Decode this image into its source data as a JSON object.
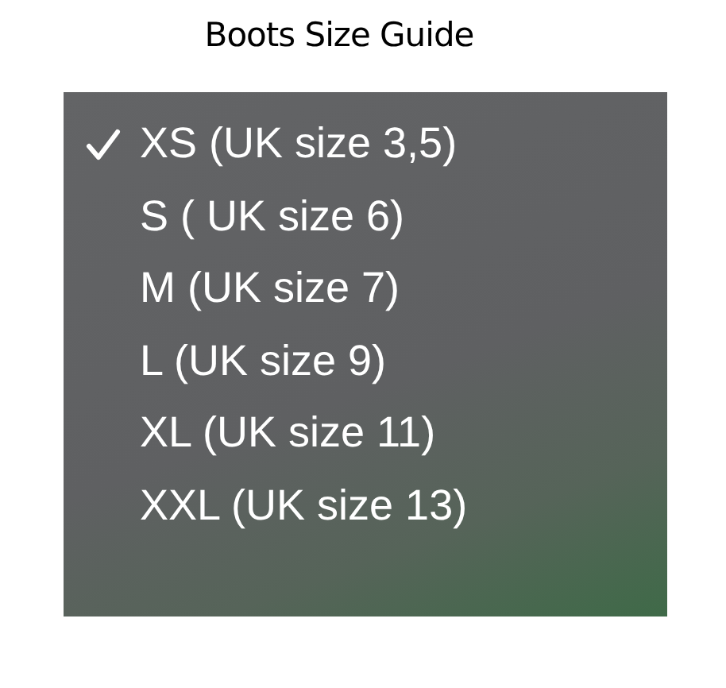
{
  "title": "Boots Size Guide",
  "menu": {
    "items": [
      {
        "label": "XS (UK size 3,5)",
        "selected": true
      },
      {
        "label": "S ( UK size 6)",
        "selected": false
      },
      {
        "label": "M (UK size 7)",
        "selected": false
      },
      {
        "label": "L (UK size 9)",
        "selected": false
      },
      {
        "label": "XL (UK size 11)",
        "selected": false
      },
      {
        "label": "XXL (UK size 13)",
        "selected": false
      }
    ]
  }
}
